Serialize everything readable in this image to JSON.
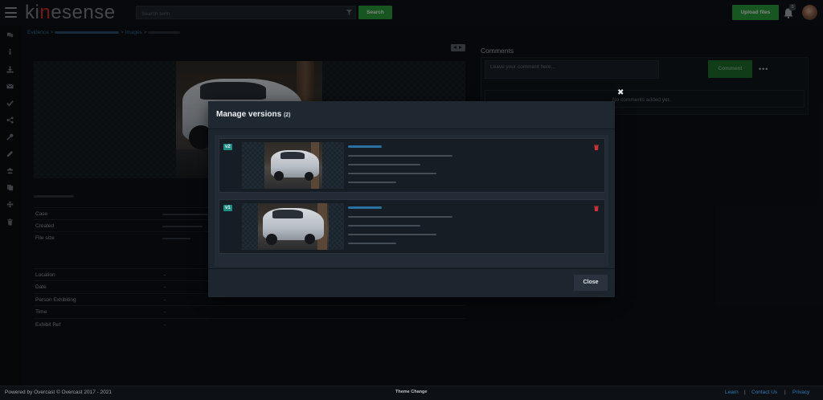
{
  "app": {
    "logo_prefix": "ki",
    "logo_highlight": "n",
    "logo_suffix": "esense"
  },
  "header": {
    "search_placeholder": "Search term",
    "search_button": "Search",
    "upload_button": "Upload files",
    "notification_count": "0"
  },
  "breadcrumb": {
    "item1": "Evidence",
    "sep1": ">",
    "sep2": ">",
    "item3": "Images",
    "sep3": ">"
  },
  "metadata": {
    "rows_top": [
      {
        "label": "Case",
        "value": ""
      },
      {
        "label": "Created",
        "value": ""
      },
      {
        "label": "File size",
        "value": ""
      }
    ],
    "rows_bottom": [
      {
        "label": "Location",
        "value": "-"
      },
      {
        "label": "Date",
        "value": "-"
      },
      {
        "label": "Person Exhibiting",
        "value": "-"
      },
      {
        "label": "Time",
        "value": "-"
      },
      {
        "label": "Exhibit Ref",
        "value": "-"
      }
    ]
  },
  "comments": {
    "title": "Comments",
    "input_placeholder": "Leave your comment here...",
    "comment_button": "Comment",
    "more_button": "•••",
    "close_icon": "✖",
    "empty_text": "No comments added yet."
  },
  "modal": {
    "title": "Manage versions",
    "count": "(2)",
    "versions": [
      {
        "badge": "v2"
      },
      {
        "badge": "v1"
      }
    ],
    "close_button": "Close"
  },
  "footer": {
    "powered": "Powered by Overcast  ©  Overcast  2017 - 2021",
    "theme": "Theme Change",
    "learn": "Learn",
    "contact": "Contact Us",
    "privacy": "Privacy",
    "sep": "|"
  },
  "colors": {
    "accent_green": "#2a9c3c",
    "badge_teal": "#1f8f86",
    "link_blue": "#2f78b0",
    "brand_red": "#c8322d",
    "delete_red": "#c8323a"
  },
  "icons": {
    "left_nav": [
      "comments-icon",
      "info-icon",
      "download-icon",
      "mail-icon",
      "check-icon",
      "share-icon",
      "key-icon",
      "edit-icon",
      "users-icon",
      "copy-icon",
      "move-icon",
      "trash-icon"
    ]
  }
}
